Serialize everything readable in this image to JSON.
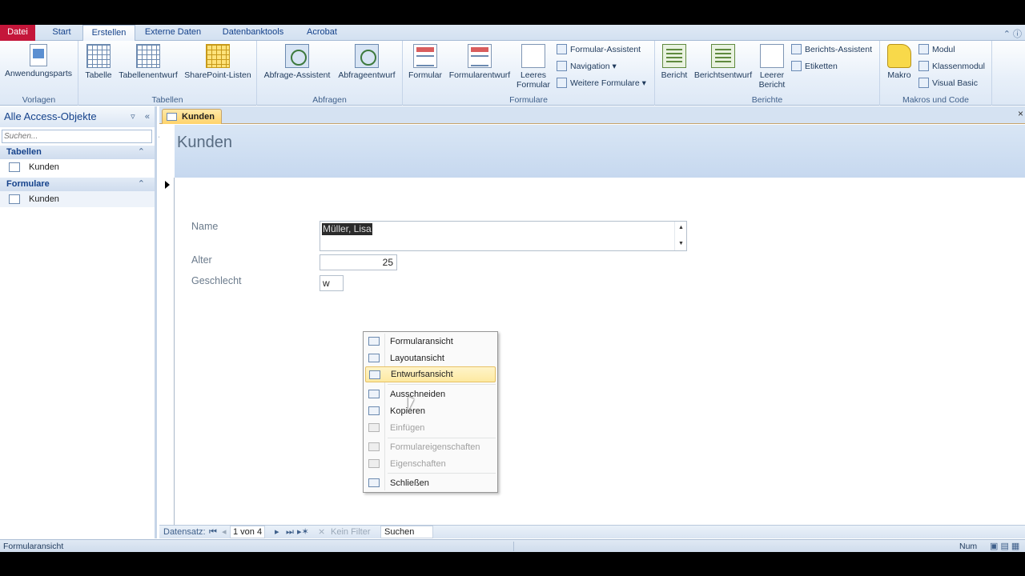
{
  "ribbon_tabs": [
    "Datei",
    "Start",
    "Erstellen",
    "Externe Daten",
    "Datenbanktools",
    "Acrobat"
  ],
  "ribbon": {
    "vorlagen": {
      "label": "Vorlagen",
      "anwendungsparts": "Anwendungsparts"
    },
    "tabellen": {
      "label": "Tabellen",
      "tabelle": "Tabelle",
      "tabellenentwurf": "Tabellenentwurf",
      "sharepoint": "SharePoint-Listen"
    },
    "abfragen": {
      "label": "Abfragen",
      "assistent": "Abfrage-Assistent",
      "entwurf": "Abfrageentwurf"
    },
    "formulare": {
      "label": "Formulare",
      "formular": "Formular",
      "formularentwurf": "Formularentwurf",
      "leeres1": "Leeres",
      "leeres2": "Formular",
      "assistent": "Formular-Assistent",
      "navigation": "Navigation",
      "weitere": "Weitere Formulare"
    },
    "berichte": {
      "label": "Berichte",
      "bericht": "Bericht",
      "berichtsentwurf": "Berichtsentwurf",
      "leerer1": "Leerer",
      "leerer2": "Bericht",
      "assistent": "Berichts-Assistent",
      "etiketten": "Etiketten"
    },
    "makros": {
      "label": "Makros und Code",
      "makro": "Makro",
      "modul": "Modul",
      "klassenmodul": "Klassenmodul",
      "vb": "Visual Basic"
    }
  },
  "nav": {
    "title": "Alle Access-Objekte",
    "search_placeholder": "Suchen...",
    "groups": [
      {
        "label": "Tabellen",
        "items": [
          "Kunden"
        ]
      },
      {
        "label": "Formulare",
        "items": [
          "Kunden"
        ]
      }
    ]
  },
  "doc": {
    "tab": "Kunden",
    "form_title": "Kunden",
    "fields": {
      "name_label": "Name",
      "name_value": "Müller, Lisa",
      "alter_label": "Alter",
      "alter_value": "25",
      "geschlecht_label": "Geschlecht",
      "geschlecht_value": "w"
    },
    "recnav": {
      "label": "Datensatz:",
      "position": "1 von 4",
      "filter": "Kein Filter",
      "search": "Suchen"
    }
  },
  "context_menu": [
    {
      "label": "Formularansicht",
      "icon": "form-view-icon",
      "disabled": false
    },
    {
      "label": "Layoutansicht",
      "icon": "layout-view-icon",
      "disabled": false
    },
    {
      "label": "Entwurfsansicht",
      "icon": "design-view-icon",
      "disabled": false,
      "highlighted": true
    },
    {
      "label": "Ausschneiden",
      "icon": "scissors-icon",
      "disabled": false
    },
    {
      "label": "Kopieren",
      "icon": "copy-icon",
      "disabled": false
    },
    {
      "label": "Einfügen",
      "icon": "paste-icon",
      "disabled": true
    },
    {
      "label": "Formulareigenschaften",
      "icon": "form-properties-icon",
      "disabled": true
    },
    {
      "label": "Eigenschaften",
      "icon": "properties-icon",
      "disabled": true
    },
    {
      "label": "Schließen",
      "icon": "close-icon",
      "disabled": false
    }
  ],
  "status": {
    "left": "Formularansicht",
    "right": "Num"
  },
  "colors": {
    "file_tab": "#c4163a",
    "doc_tab": "#ffd36a",
    "form_header": "#c6d8ef",
    "menu_highlight": "#fde9a1"
  }
}
